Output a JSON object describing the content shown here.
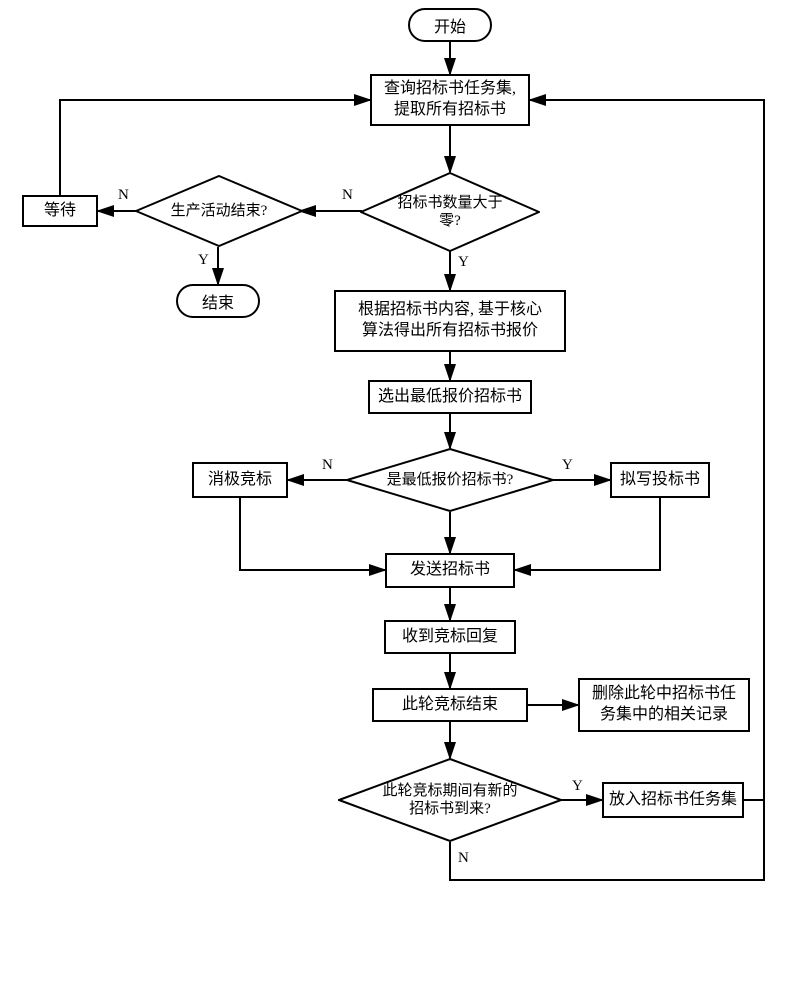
{
  "nodes": {
    "start": "开始",
    "end": "结束",
    "query": "查询招标书任务集,\n提取所有招标书",
    "wait": "等待",
    "d_count": "招标书数量大于\n零?",
    "d_prod_end": "生产活动结束?",
    "calc": "根据招标书内容, 基于核心\n算法得出所有招标书报价",
    "select_min": "选出最低报价招标书",
    "d_lowest": "是最低报价招标书?",
    "passive": "消极竞标",
    "draft": "拟写投标书",
    "send": "发送招标书",
    "receive": "收到竞标回复",
    "round_end": "此轮竞标结束",
    "delete_rec": "删除此轮中招标书任\n务集中的相关记录",
    "d_new": "此轮竞标期间有新的\n招标书到来?",
    "put_set": "放入招标书任务集"
  },
  "labels": {
    "y": "Y",
    "n": "N"
  }
}
